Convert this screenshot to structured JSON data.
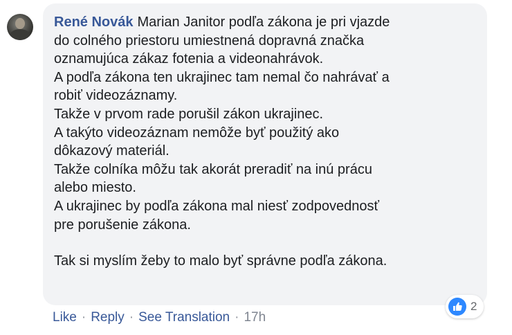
{
  "comment": {
    "author": "René Novák",
    "lines": [
      "Marian Janitor podľa zákona je pri vjazde",
      "do colného priestoru umiestnená dopravná značka",
      "oznamujúca zákaz fotenia a videonahrávok.",
      "A podľa zákona ten ukrajinec tam nemal čo nahrávať a",
      "robiť videozáznamy.",
      "Takže v prvom rade porušil zákon ukrajinec.",
      "A takýto videozáznam nemôže byť použitý ako",
      "dôkazový materiál.",
      "Takže colníka môžu tak akorát preradiť na inú prácu",
      "alebo miesto.",
      "A ukrajinec by podľa zákona mal niesť zodpovednosť",
      "pre porušenie zákona.",
      "Tak si myslím žeby to malo byť správne podľa zákona."
    ]
  },
  "reactions": {
    "icon": "like-icon",
    "count": "2",
    "color": "#2d88ff"
  },
  "actions": {
    "like": "Like",
    "reply": "Reply",
    "see_translation": "See Translation",
    "time": "17h",
    "separator": "·"
  },
  "colors": {
    "link": "#385898",
    "bubble": "#f2f3f5",
    "text": "#1c1e21"
  }
}
